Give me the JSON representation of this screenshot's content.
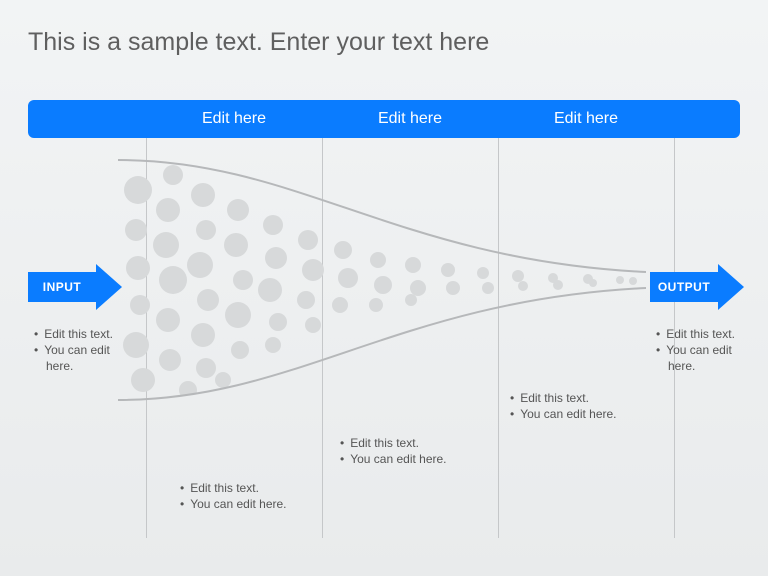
{
  "title": "This is a sample text. Enter your text here",
  "header": {
    "col1": "Edit here",
    "col2": "Edit here",
    "col3": "Edit here"
  },
  "input_arrow": {
    "label": "INPUT"
  },
  "output_arrow": {
    "label": "OUTPUT"
  },
  "bullets": {
    "input": {
      "l1": "Edit this text.",
      "l2": "You can edit",
      "l3": "here."
    },
    "col1": {
      "l1": "Edit this text.",
      "l2": "You can edit here."
    },
    "col2": {
      "l1": "Edit this text.",
      "l2": "You can edit here."
    },
    "col3": {
      "l1": "Edit this text.",
      "l2": "You can edit here."
    },
    "output": {
      "l1": "Edit this text.",
      "l2": "You can edit",
      "l3": "here."
    }
  },
  "colors": {
    "accent": "#0a7cff",
    "funnel_stroke": "#b6b8ba",
    "dots": "#d7d9da"
  }
}
